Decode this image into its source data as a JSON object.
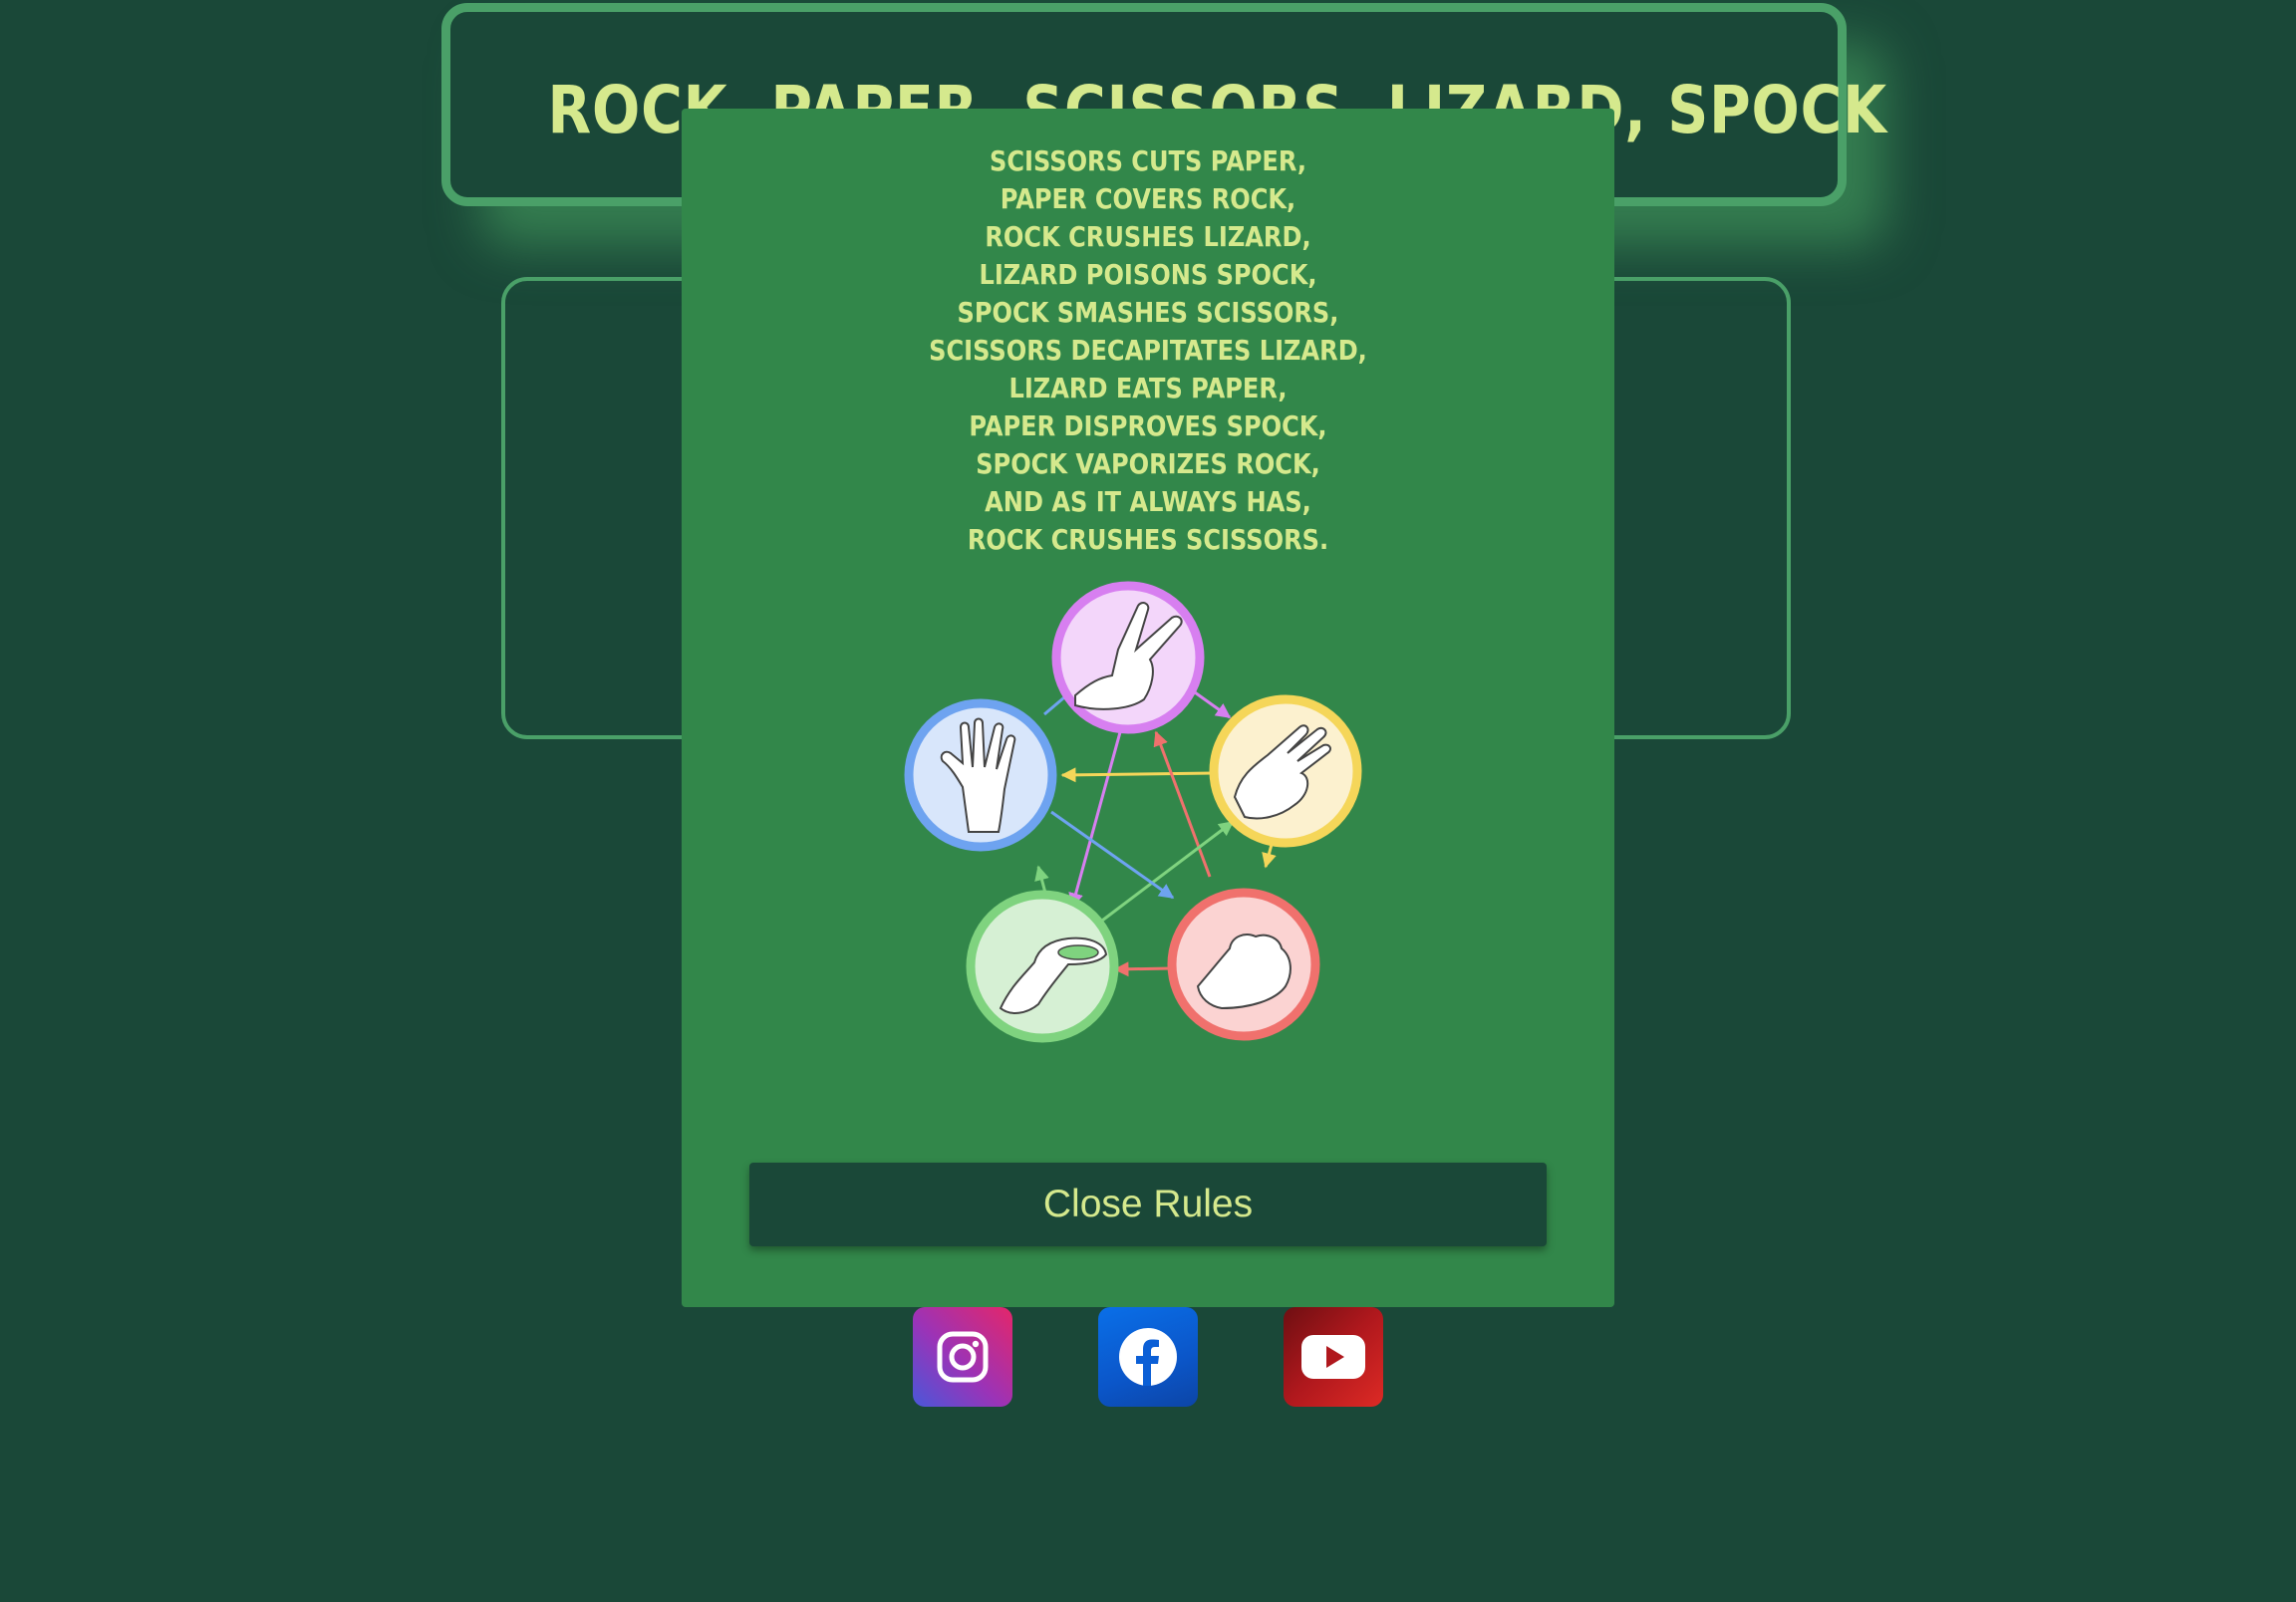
{
  "header": {
    "title": "ROCK, PAPER, SCISSORS, LIZARD, SPOCK"
  },
  "rules_modal": {
    "lines": [
      "SCISSORS CUTS PAPER,",
      "PAPER COVERS ROCK,",
      "ROCK CRUSHES LIZARD,",
      "LIZARD POISONS SPOCK,",
      "SPOCK SMASHES SCISSORS,",
      "SCISSORS DECAPITATES LIZARD,",
      "LIZARD EATS PAPER,",
      "PAPER DISPROVES SPOCK,",
      "SPOCK VAPORIZES ROCK,",
      "AND AS IT ALWAYS HAS,",
      "ROCK CRUSHES SCISSORS."
    ],
    "close_label": "Close Rules"
  },
  "diagram": {
    "icons": [
      "scissors-icon",
      "paper-icon",
      "rock-icon",
      "lizard-icon",
      "spock-icon"
    ],
    "colors": {
      "scissors": "#d77ff0",
      "paper": "#f5d659",
      "rock": "#f0716d",
      "lizard": "#7fd37f",
      "spock": "#6ea3f0"
    }
  },
  "social": {
    "icons": [
      "instagram-icon",
      "facebook-icon",
      "youtube-icon"
    ]
  },
  "colors": {
    "background": "#1a4838",
    "modal": "#32874a",
    "accent_text": "#d5e98d",
    "border": "#4aa068"
  }
}
